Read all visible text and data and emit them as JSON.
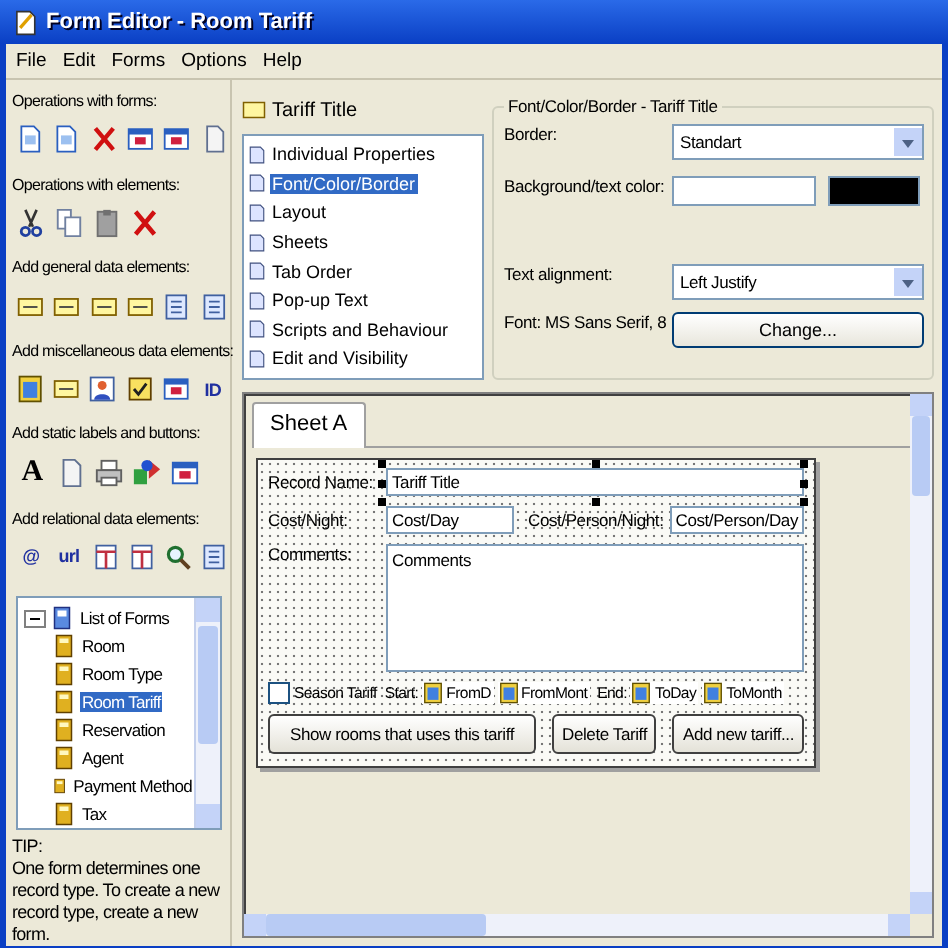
{
  "window": {
    "title": "Form Editor - Room Tariff"
  },
  "menu": [
    {
      "label": "File"
    },
    {
      "label": "Edit"
    },
    {
      "label": "Forms"
    },
    {
      "label": "Options"
    },
    {
      "label": "Help"
    }
  ],
  "toolbox": {
    "groups": [
      {
        "label": "Operations with forms:",
        "tools": [
          {
            "kind": "doc"
          },
          {
            "kind": "doc"
          },
          {
            "kind": "delete"
          },
          {
            "kind": "window"
          },
          {
            "kind": "window"
          },
          {
            "kind": "page"
          }
        ]
      },
      {
        "label": "Operations with elements:",
        "tools": [
          {
            "kind": "cut"
          },
          {
            "kind": "copy"
          },
          {
            "kind": "paste"
          },
          {
            "kind": "delete"
          }
        ]
      },
      {
        "label": "Add general data elements:",
        "tools": [
          {
            "kind": "field"
          },
          {
            "kind": "field"
          },
          {
            "kind": "field"
          },
          {
            "kind": "field"
          },
          {
            "kind": "list"
          },
          {
            "kind": "list"
          }
        ]
      },
      {
        "label": "Add miscellaneous data elements:",
        "tools": [
          {
            "kind": "calendar"
          },
          {
            "kind": "field"
          },
          {
            "kind": "person"
          },
          {
            "kind": "check"
          },
          {
            "kind": "window"
          },
          {
            "kind": "glyph",
            "text": "ID"
          }
        ]
      },
      {
        "label": "Add static labels and buttons:",
        "tools": [
          {
            "kind": "glyph",
            "text": "A"
          },
          {
            "kind": "page"
          },
          {
            "kind": "printer"
          },
          {
            "kind": "shapes"
          },
          {
            "kind": "window"
          }
        ]
      },
      {
        "label": "Add relational data elements:",
        "tools": [
          {
            "kind": "glyph",
            "text": "@"
          },
          {
            "kind": "glyph",
            "text": "url"
          },
          {
            "kind": "table"
          },
          {
            "kind": "table"
          },
          {
            "kind": "search"
          },
          {
            "kind": "list"
          }
        ]
      }
    ],
    "tree": {
      "items": [
        {
          "label": "List of Forms",
          "expanded": true,
          "selected": false,
          "children": [
            {
              "label": "Room",
              "selected": false
            },
            {
              "label": "Room Type",
              "selected": false
            },
            {
              "label": "Room Tariff",
              "selected": true
            },
            {
              "label": "Reservation",
              "selected": false
            },
            {
              "label": "Agent",
              "selected": false
            },
            {
              "label": "Payment Method",
              "selected": false
            },
            {
              "label": "Tax",
              "selected": false
            }
          ]
        }
      ]
    },
    "tip": {
      "title": "TIP:",
      "text": "One form determines one record type. To create a new record type, create a new form."
    }
  },
  "properties": {
    "element": "Tariff Title",
    "pages": [
      {
        "label": "Individual Properties",
        "selected": false
      },
      {
        "label": "Font/Color/Border",
        "selected": true
      },
      {
        "label": "Layout",
        "selected": false
      },
      {
        "label": "Sheets",
        "selected": false
      },
      {
        "label": "Tab Order",
        "selected": false
      },
      {
        "label": "Pop-up Text",
        "selected": false
      },
      {
        "label": "Scripts and Behaviour",
        "selected": false
      },
      {
        "label": "Edit and Visibility",
        "selected": false
      }
    ],
    "group": {
      "title": "Font/Color/Border - Tariff Title",
      "border": {
        "label": "Border:",
        "value": "Standart"
      },
      "colors": {
        "label": "Background/text color:",
        "swatches": [
          {
            "color": "#ffffff"
          },
          {
            "color": "#000000"
          }
        ]
      },
      "alignment": {
        "label": "Text alignment:",
        "value": "Left Justify"
      },
      "font": "Font: MS Sans Serif, 8",
      "change_button": "Change..."
    }
  },
  "designer": {
    "tabs": [
      {
        "label": "Sheet A",
        "selected": true
      }
    ],
    "record": {
      "label": "Record Name:",
      "value": "Tariff Title",
      "selected": true
    },
    "cost": [
      {
        "label": "Cost/Night:",
        "value": "Cost/Day"
      },
      {
        "label": "Cost/Person/Night:",
        "value": "Cost/Person/Day"
      }
    ],
    "comments": {
      "label": "Comments:",
      "value": "Comments"
    },
    "season": {
      "label": "Season Tariff",
      "checked": false
    },
    "dates": [
      {
        "label": "Start:",
        "fields": [
          "FromD",
          "FromMont"
        ]
      },
      {
        "label": "End:",
        "fields": [
          "ToDay",
          "ToMonth"
        ]
      }
    ],
    "buttons": [
      {
        "label": "Show rooms that uses this tariff"
      },
      {
        "label": "Delete Tariff"
      },
      {
        "label": "Add new tariff..."
      }
    ]
  }
}
